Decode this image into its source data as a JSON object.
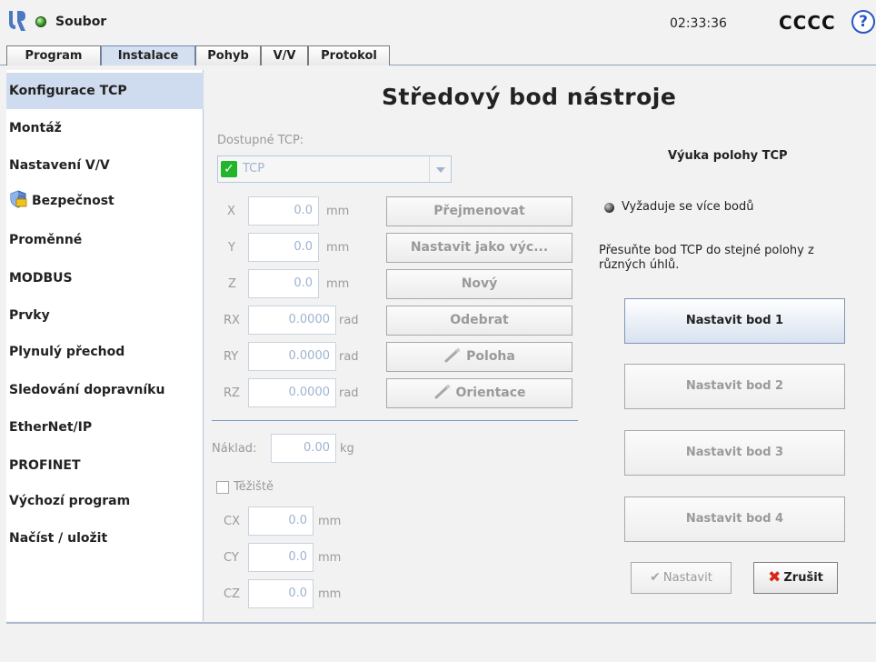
{
  "header": {
    "file_label": "Soubor",
    "clock": "02:33:36",
    "robot_name": "CCCC",
    "help_symbol": "?"
  },
  "tabs": [
    "Program",
    "Instalace",
    "Pohyb",
    "V/V",
    "Protokol"
  ],
  "active_tab": "Instalace",
  "sidebar": {
    "items": [
      {
        "label": "Konfigurace TCP",
        "selected": true
      },
      {
        "label": "Montáž"
      },
      {
        "label": "Nastavení V/V"
      },
      {
        "label": "Bezpečnost",
        "icon": "shield-icon"
      },
      {
        "label": "Proměnné"
      },
      {
        "label": "MODBUS"
      },
      {
        "label": "Prvky"
      },
      {
        "label": "Plynulý přechod"
      },
      {
        "label": "Sledování dopravníku"
      },
      {
        "label": "EtherNet/IP"
      },
      {
        "label": "PROFINET"
      },
      {
        "label": "Výchozí program"
      },
      {
        "label": "Načíst / uložit"
      }
    ]
  },
  "main": {
    "title": "Středový bod nástroje",
    "tcp_caption": "Dostupné TCP:",
    "tcp_selected": "TCP",
    "coords": [
      {
        "label": "X",
        "value": "0.0",
        "unit": "mm"
      },
      {
        "label": "Y",
        "value": "0.0",
        "unit": "mm"
      },
      {
        "label": "Z",
        "value": "0.0",
        "unit": "mm"
      },
      {
        "label": "RX",
        "value": "0.0000",
        "unit": "rad"
      },
      {
        "label": "RY",
        "value": "0.0000",
        "unit": "rad"
      },
      {
        "label": "RZ",
        "value": "0.0000",
        "unit": "rad"
      }
    ],
    "actions": {
      "rename": "Přejmenovat",
      "set_default": "Nastavit jako výc...",
      "new": "Nový",
      "remove": "Odebrat",
      "position": "Poloha",
      "orientation": "Orientace"
    },
    "payload_label": "Náklad:",
    "payload_value": "0.00",
    "payload_unit": "kg",
    "cog_label": "Těžiště",
    "cog_coords": [
      {
        "label": "CX",
        "value": "0.0",
        "unit": "mm"
      },
      {
        "label": "CY",
        "value": "0.0",
        "unit": "mm"
      },
      {
        "label": "CZ",
        "value": "0.0",
        "unit": "mm"
      }
    ]
  },
  "teach": {
    "title": "Výuka polohy TCP",
    "requirement": "Vyžaduje se více bodů",
    "instruction": "Přesuňte bod TCP do stejné polohy z různých úhlů.",
    "points": [
      "Nastavit bod 1",
      "Nastavit bod 2",
      "Nastavit bod 3",
      "Nastavit bod 4"
    ],
    "set_label": "Nastavit",
    "cancel_label": "Zrušit"
  },
  "colors": {
    "status_ok": "#2e8f1c",
    "selection": "#cfdcef",
    "help": "#2a55c9",
    "cancel_x": "#d8261a"
  }
}
